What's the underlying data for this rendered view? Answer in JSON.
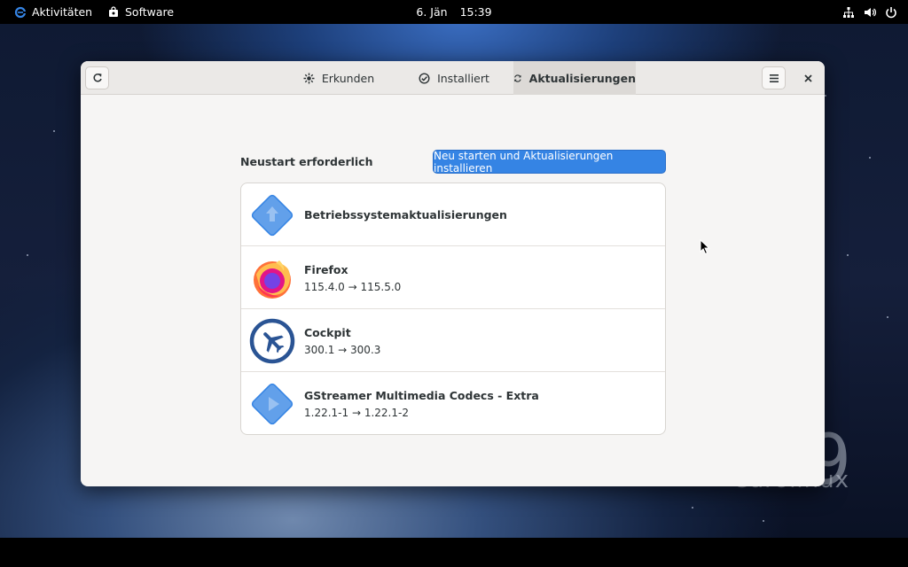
{
  "topbar": {
    "activities": "Aktivitäten",
    "app": "Software",
    "date": "6. Jän",
    "time": "15:39",
    "icons": [
      "network-icon",
      "volume-icon",
      "power-icon"
    ]
  },
  "desktop": {
    "brand": "eurolinux",
    "brand_number": "9"
  },
  "window": {
    "tabs": [
      {
        "label": "Erkunden",
        "icon": "explore-icon"
      },
      {
        "label": "Installiert",
        "icon": "installed-check-icon"
      },
      {
        "label": "Aktualisierungen",
        "icon": "updates-refresh-icon",
        "active": true
      }
    ],
    "section_title": "Neustart erforderlich",
    "restart_button": "Neu starten und Aktualisierungen installieren",
    "updates": [
      {
        "name": "Betriebssystemaktualisierungen",
        "version": "",
        "icon": "os-update-icon"
      },
      {
        "name": "Firefox",
        "version": "115.4.0 → 115.5.0",
        "icon": "firefox-icon"
      },
      {
        "name": "Cockpit",
        "version": "300.1 → 300.3",
        "icon": "cockpit-icon"
      },
      {
        "name": "GStreamer Multimedia Codecs - Extra",
        "version": "1.22.1-1 → 1.22.1-2",
        "icon": "gstreamer-icon"
      }
    ]
  },
  "colors": {
    "accent": "#3584e4",
    "topbar": "#000000",
    "window_bg": "#f6f5f4"
  }
}
